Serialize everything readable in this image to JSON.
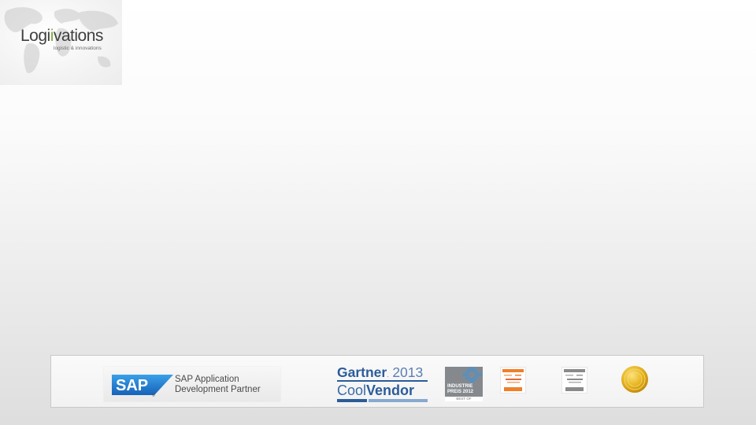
{
  "logo": {
    "name_part1": "Logi",
    "name_part2": "vations",
    "tagline": "logistic & innovations",
    "colors": {
      "accent": "#7cab3a",
      "text": "#3f3f3f"
    }
  },
  "partners": {
    "sap": {
      "logo_text": "SAP",
      "label": "SAP Application\nDevelopment Partner",
      "colors": {
        "blue": "#1a6fc1"
      }
    },
    "gartner": {
      "name": "Gartner",
      "year": "2013",
      "cool": "Cool",
      "vendor": "Vendor"
    },
    "industriepreis": {
      "label": "INDUSTRIE\nPREIS 2012",
      "footer": "BEST OF"
    },
    "badges": [
      "orange-award-badge",
      "grey-award-badge",
      "gold-seal-icon"
    ]
  }
}
